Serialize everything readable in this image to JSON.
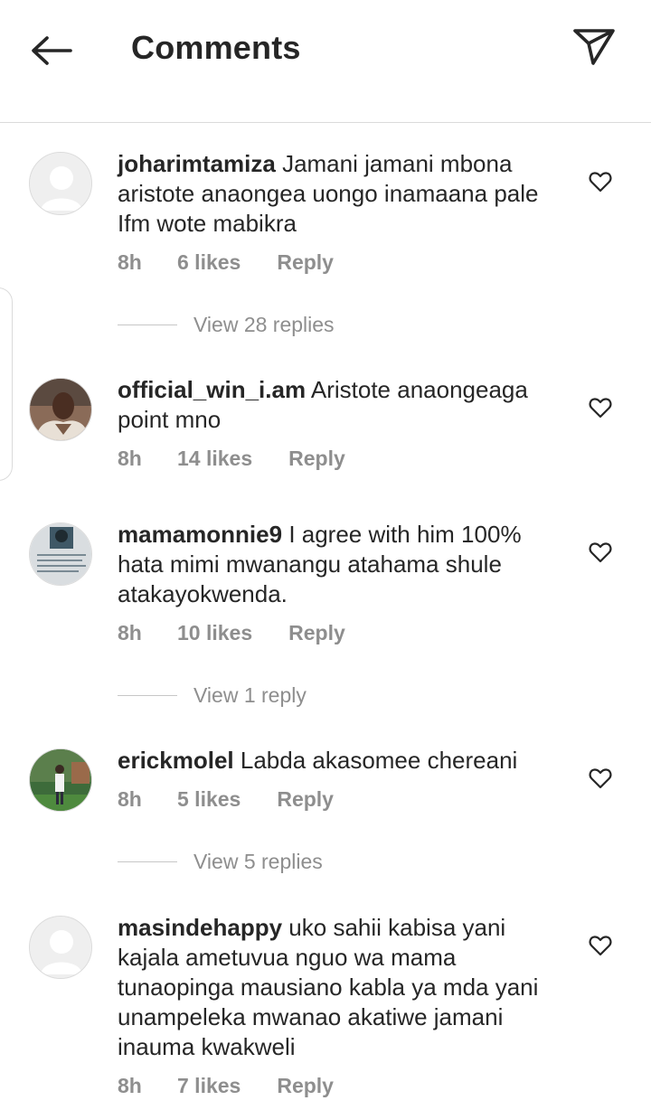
{
  "header": {
    "title": "Comments",
    "back_icon": "arrow-left-icon",
    "send_icon": "paper-plane-icon"
  },
  "comments": [
    {
      "username": "joharimtamiza",
      "text": "Jamani jamani mbona aristote anaongea uongo inamaana pale Ifm wote mabikra",
      "time": "8h",
      "likes": "6 likes",
      "reply": "Reply",
      "view_replies": "View 28 replies",
      "avatar": "default-avatar"
    },
    {
      "username": "official_win_i.am",
      "text": "Aristote anaongeaga point mno",
      "time": "8h",
      "likes": "14 likes",
      "reply": "Reply",
      "avatar": "photo-avatar"
    },
    {
      "username": "mamamonnie9",
      "text": "I agree with him 100% hata mimi mwanangu atahama shule atakayokwenda.",
      "time": "8h",
      "likes": "10 likes",
      "reply": "Reply",
      "view_replies": "View 1 reply",
      "avatar": "photo-avatar"
    },
    {
      "username": "erickmolel",
      "text": "Labda akasomee chereani",
      "time": "8h",
      "likes": "5 likes",
      "reply": "Reply",
      "view_replies": "View 5 replies",
      "avatar": "photo-avatar"
    },
    {
      "username": "masindehappy",
      "text": "uko sahii kabisa yani kajala ametuvua nguo wa mama tunaopinga mausiano kabla ya mda yani unampeleka mwanao akatiwe jamani inauma kwakweli",
      "time": "8h",
      "likes": "7 likes",
      "reply": "Reply",
      "avatar": "default-avatar"
    }
  ],
  "colors": {
    "text": "#262626",
    "secondary": "#8e8e8e",
    "divider": "#dbdbdb"
  }
}
